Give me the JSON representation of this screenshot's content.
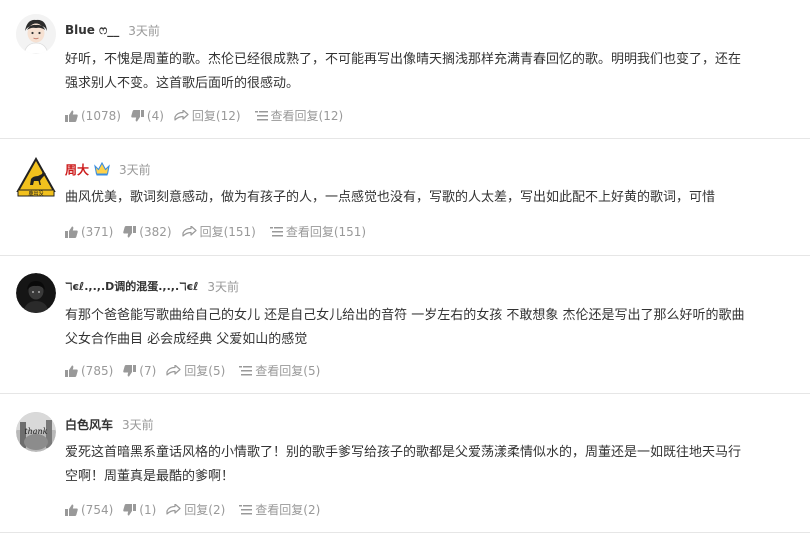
{
  "comments": [
    {
      "username": "Blue ෆ__",
      "time": "3天前",
      "content": "好听，不愧是周董的歌。杰伦已经很成熟了，不可能再写出像晴天搁浅那样充满青春回忆的歌。明明我们也变了，还在\n强求别人不变。这首歌后面听的很感动。",
      "likes": "(1078)",
      "dislikes": "(4)",
      "reply": "回复(12)",
      "view_replies": "查看回复(12)"
    },
    {
      "username": "周大",
      "time": "3天前",
      "content": "曲风优美，歌词刻意感动，做为有孩子的人，一点感觉也没有，写歌的人太差，写出如此配不上好黄的歌词，可惜",
      "likes": "(371)",
      "dislikes": "(382)",
      "reply": "回复(151)",
      "view_replies": "查看回复(151)"
    },
    {
      "username": "ℸєℓ.,.,.D调的混蛋.,.,.ℸєℓ",
      "time": "3天前",
      "content": "有那个爸爸能写歌曲给自己的女儿 还是自己女儿给出的音符 一岁左右的女孩 不敢想象 杰伦还是写出了那么好听的歌曲\n父女合作曲目 必会成经典 父爱如山的感觉",
      "likes": "(785)",
      "dislikes": "(7)",
      "reply": "回复(5)",
      "view_replies": "查看回复(5)"
    },
    {
      "username": "白色风车",
      "time": "3天前",
      "content": "爱死这首暗黑系童话风格的小情歌了！别的歌手爹写给孩子的歌都是父爱荡漾柔情似水的，周董还是一如既往地天马行\n空啊！周董真是最酷的爹啊！",
      "likes": "(754)",
      "dislikes": "(1)",
      "reply": "回复(2)",
      "view_replies": "查看回复(2)"
    }
  ],
  "avatar2_text": "鹿出没",
  "avatar4_text": "thank",
  "colors": {
    "name_highlight": "#cc1a1a",
    "meta_gray": "#999999",
    "text": "#333333",
    "divider": "#e6e6e6",
    "deer_sign_yellow": "#f2c11d"
  }
}
